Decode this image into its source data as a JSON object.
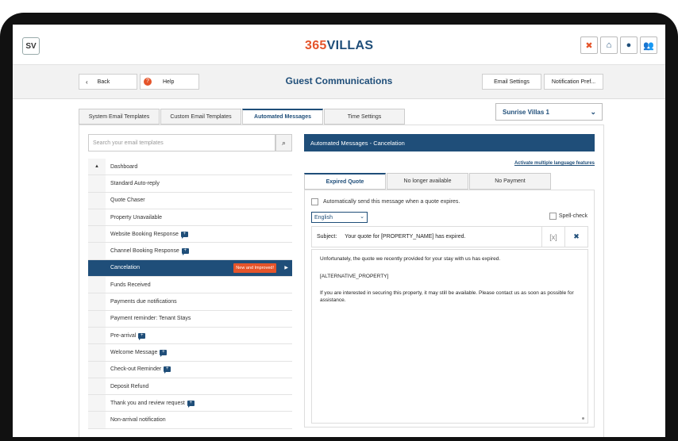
{
  "colors": {
    "accent": "#1f4e79",
    "brand_orange": "#e5542a"
  },
  "header": {
    "user_initials": "SV",
    "logo_number": "365",
    "logo_word": "VILLAS",
    "icons": [
      "tools-icon",
      "home-icon",
      "location-pin-icon",
      "users-icon"
    ]
  },
  "subbar": {
    "back_label": "Back",
    "help_label": "Help",
    "page_title": "Guest Communications",
    "email_settings_label": "Email Settings",
    "notification_prefs_label": "Notification Pref..."
  },
  "property_select": {
    "value": "Sunrise Villas 1"
  },
  "tabs": [
    {
      "label": "System Email Templates"
    },
    {
      "label": "Custom Email Templates"
    },
    {
      "label": "Automated Messages",
      "active": true
    },
    {
      "label": "Time Settings"
    }
  ],
  "search": {
    "placeholder": "Search your email templates"
  },
  "templates": [
    {
      "label": "Dashboard",
      "gutter": "▲"
    },
    {
      "label": "Standard Auto-reply"
    },
    {
      "label": "Quote Chaser"
    },
    {
      "label": "Property Unavailable"
    },
    {
      "label": "Website Booking Response",
      "icon": true
    },
    {
      "label": "Channel Booking Response",
      "icon": true
    },
    {
      "label": "Cancelation",
      "active": true,
      "badge": "New and Improved!"
    },
    {
      "label": "Funds Received"
    },
    {
      "label": "Payments due notifications"
    },
    {
      "label": "Payment reminder: Tenant Stays"
    },
    {
      "label": "Pre-arrival",
      "icon": true
    },
    {
      "label": "Welcome Message",
      "icon": true
    },
    {
      "label": "Check-out Reminder",
      "icon": true
    },
    {
      "label": "Deposit Refund"
    },
    {
      "label": "Thank you and review request",
      "icon": true
    },
    {
      "label": "Non-arrival notification"
    }
  ],
  "message": {
    "header": "Automated Messages - Cancelation",
    "activate_link": "Activate multiple language features",
    "tabs": [
      {
        "label": "Expired Quote",
        "active": true
      },
      {
        "label": "No longer available"
      },
      {
        "label": "No Payment"
      }
    ],
    "auto_send_label": "Automatically send this message when a quote expires.",
    "language": "English",
    "spellcheck_label": "Spell-check",
    "subject_label": "Subject:",
    "subject_value": "Your quote for [PROPERTY_NAME] has expired.",
    "body": [
      "Unfortunately, the quote we recently provided for your stay with us has expired.",
      "[ALTERNATIVE_PROPERTY]",
      "If you are interested in securing this property, it may still be available. Please contact us as soon as possible for assistance."
    ]
  }
}
